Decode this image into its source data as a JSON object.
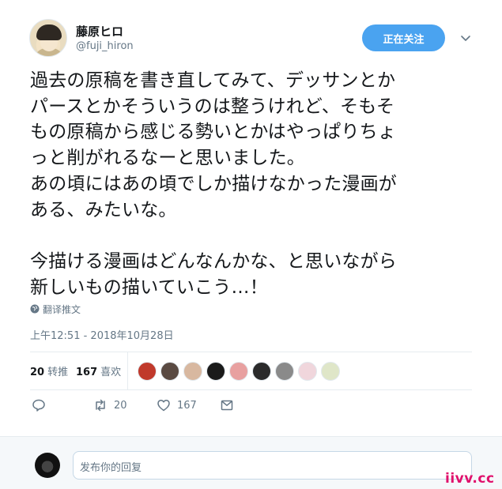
{
  "user": {
    "display_name": "藤原ヒロ",
    "handle": "@fuji_hiron"
  },
  "follow_button": {
    "label": "正在关注"
  },
  "tweet": {
    "text": "過去の原稿を書き直してみて、デッサンとか\nパースとかそういうのは整うけれど、そもそ\nもの原稿から感じる勢いとかはやっぱりちょ\nっと削がれるなーと思いました。\nあの頃にはあの頃でしか描けなかった漫画が\nある、みたいな。\n\n今描ける漫画はどんなんかな、と思いながら\n新しいもの描いていこう…！",
    "translate_label": "翻译推文",
    "timestamp": "上午12:51 - 2018年10月28日"
  },
  "stats": {
    "retweets_count": "20",
    "retweets_label": "转推",
    "likes_count": "167",
    "likes_label": "喜欢",
    "liker_colors": [
      "#c0392b",
      "#5a4a42",
      "#d8b8a0",
      "#1a1a1a",
      "#e8a0a0",
      "#2b2b2b",
      "#8a8a8a",
      "#f0d6dc",
      "#dfe6c8"
    ]
  },
  "actions": {
    "reply_icon": "reply-icon",
    "retweet_count": "20",
    "like_count": "167",
    "dm_icon": "mail-icon"
  },
  "reply": {
    "placeholder": "发布你的回复"
  },
  "watermark": "iivv.cc",
  "colors": {
    "accent": "#4aa3f0",
    "muted": "#657786",
    "text": "#14171a"
  }
}
